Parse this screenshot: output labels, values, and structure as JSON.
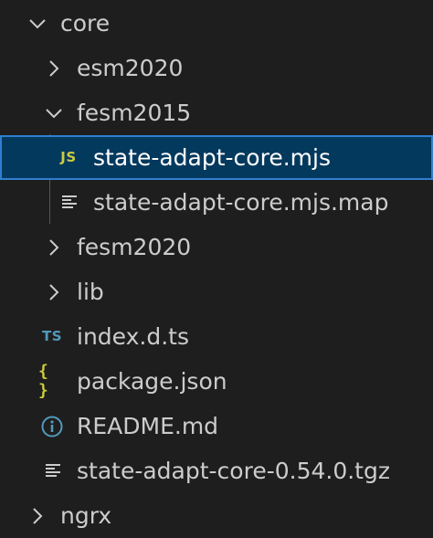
{
  "explorer": {
    "items": [
      {
        "label": "core",
        "icon": "chevron-down-icon"
      },
      {
        "label": "esm2020",
        "icon": "chevron-right-icon"
      },
      {
        "label": "fesm2015",
        "icon": "chevron-down-icon"
      },
      {
        "label": "state-adapt-core.mjs",
        "icon": "js-file-icon",
        "icon_text": "JS",
        "selected": true
      },
      {
        "label": "state-adapt-core.mjs.map",
        "icon": "lines-file-icon"
      },
      {
        "label": "fesm2020",
        "icon": "chevron-right-icon"
      },
      {
        "label": "lib",
        "icon": "chevron-right-icon"
      },
      {
        "label": "index.d.ts",
        "icon": "ts-file-icon",
        "icon_text": "TS"
      },
      {
        "label": "package.json",
        "icon": "json-file-icon",
        "icon_text": "{ }"
      },
      {
        "label": "README.md",
        "icon": "info-icon",
        "icon_text": "i"
      },
      {
        "label": "state-adapt-core-0.54.0.tgz",
        "icon": "lines-file-icon"
      },
      {
        "label": "ngrx",
        "icon": "chevron-right-icon"
      }
    ]
  },
  "colors": {
    "background": "#1e1e1e",
    "selection_background": "#04395e",
    "selection_border": "#2f7fd0",
    "js_icon": "#cbcb41",
    "ts_icon": "#519aba",
    "info_icon": "#519aba"
  }
}
